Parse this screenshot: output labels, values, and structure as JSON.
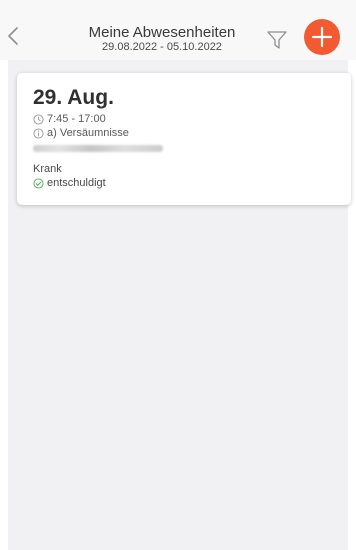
{
  "header": {
    "title": "Meine Abwesenheiten",
    "date_range": "29.08.2022 - 05.10.2022",
    "back_icon": "chevron-left-icon",
    "filter_icon": "filter-icon",
    "add_icon": "plus-icon"
  },
  "absences": [
    {
      "date": "29. Aug.",
      "time": "7:45 - 17:00",
      "reason": "a) Versäumnisse",
      "type": "Krank",
      "status": "entschuldigt"
    }
  ],
  "colors": {
    "accent": "#f25a32",
    "status_ok": "#4caf50",
    "background": "#f1f1f3"
  }
}
